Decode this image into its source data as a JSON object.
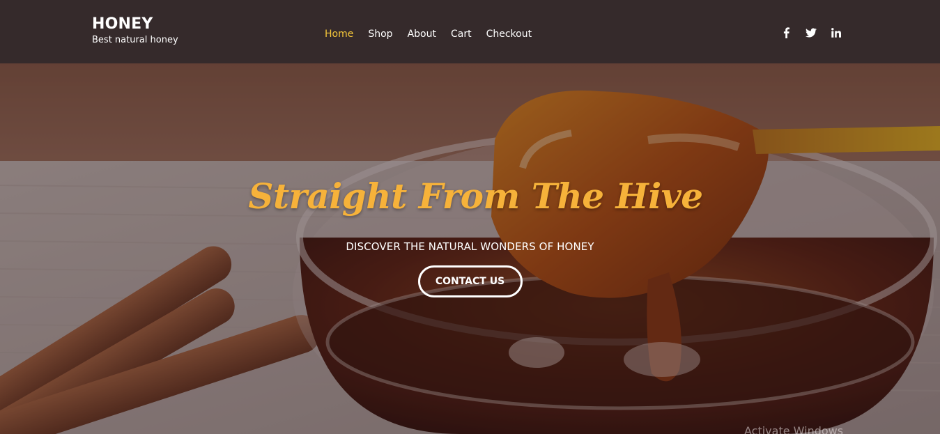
{
  "brand": {
    "title": "HONEY",
    "tagline": "Best natural honey"
  },
  "nav": {
    "items": [
      {
        "label": "Home",
        "active": true
      },
      {
        "label": "Shop",
        "active": false
      },
      {
        "label": "About",
        "active": false
      },
      {
        "label": "Cart",
        "active": false
      },
      {
        "label": "Checkout",
        "active": false
      }
    ]
  },
  "socials": {
    "items": [
      {
        "icon": "facebook-icon"
      },
      {
        "icon": "twitter-icon"
      },
      {
        "icon": "linkedin-icon"
      }
    ]
  },
  "hero": {
    "title": "Straight From The Hive",
    "subtitle": "DISCOVER THE NATURAL WONDERS OF HONEY",
    "button_label": "CONTACT US",
    "background": "honey-spoon-photo"
  },
  "watermark": {
    "text": "Activate Windows"
  },
  "colors": {
    "header_bg": "#352a2b",
    "accent": "#f4c63a",
    "title": "#f6b23a",
    "text": "#ffffff"
  }
}
